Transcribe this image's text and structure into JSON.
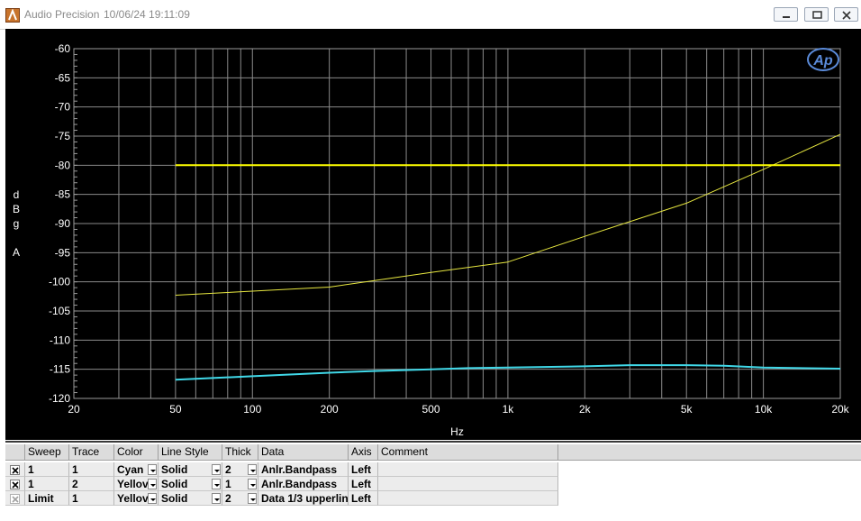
{
  "window": {
    "app_title": "Audio Precision",
    "timestamp": "10/06/24 19:11:09",
    "controls": [
      "minimize-icon",
      "restore-icon",
      "close-icon"
    ]
  },
  "chart_data": {
    "type": "line",
    "xscale": "log",
    "xlim": [
      20,
      20000
    ],
    "ylim": [
      -120,
      -60
    ],
    "xlabel": "Hz",
    "ylabel_lines": [
      "d",
      "B",
      "g",
      "",
      "A"
    ],
    "x_ticks": [
      {
        "v": 20,
        "label": "20"
      },
      {
        "v": 50,
        "label": "50"
      },
      {
        "v": 100,
        "label": "100"
      },
      {
        "v": 200,
        "label": "200"
      },
      {
        "v": 500,
        "label": "500"
      },
      {
        "v": 1000,
        "label": "1k"
      },
      {
        "v": 2000,
        "label": "2k"
      },
      {
        "v": 5000,
        "label": "5k"
      },
      {
        "v": 10000,
        "label": "10k"
      },
      {
        "v": 20000,
        "label": "20k"
      }
    ],
    "y_ticks": [
      -60,
      -65,
      -70,
      -75,
      -80,
      -85,
      -90,
      -95,
      -100,
      -105,
      -110,
      -115,
      -120
    ],
    "grid": true,
    "logo": "Ap",
    "series": [
      {
        "color": "#40d8e8",
        "thick": 2,
        "x": [
          50,
          100,
          200,
          300,
          500,
          700,
          1000,
          2000,
          3000,
          5000,
          7000,
          10000,
          20000
        ],
        "y": [
          -116.8,
          -116.2,
          -115.6,
          -115.3,
          -115.0,
          -114.8,
          -114.7,
          -114.5,
          -114.3,
          -114.3,
          -114.4,
          -114.7,
          -114.9
        ]
      },
      {
        "color": "#e8e840",
        "thick": 1,
        "x": [
          50,
          100,
          200,
          500,
          1000,
          2000,
          5000,
          10000,
          20000
        ],
        "y": [
          -102.3,
          -101.6,
          -100.9,
          -98.4,
          -96.6,
          -92.2,
          -86.5,
          -80.7,
          -74.7
        ]
      },
      {
        "color": "#ffff00",
        "thick": 2,
        "x": [
          50,
          20000
        ],
        "y": [
          -80,
          -80
        ]
      }
    ]
  },
  "table": {
    "headers": [
      "Sweep",
      "Trace",
      "Color",
      "Line Style",
      "Thick",
      "Data",
      "Axis",
      "Comment"
    ],
    "rows": [
      {
        "sweep": "1",
        "trace": "1",
        "color": "Cyan",
        "style": "Solid",
        "thick": "2",
        "data": "Anlr.Bandpass",
        "axis": "Left",
        "comment": ""
      },
      {
        "sweep": "1",
        "trace": "2",
        "color": "Yellov",
        "style": "Solid",
        "thick": "1",
        "data": "Anlr.Bandpass",
        "axis": "Left",
        "comment": ""
      },
      {
        "sweep": "Limit",
        "trace": "1",
        "color": "Yellov",
        "style": "Solid",
        "thick": "2",
        "data": "Data 1/3 upperlin",
        "axis": "Left",
        "comment": ""
      }
    ]
  }
}
